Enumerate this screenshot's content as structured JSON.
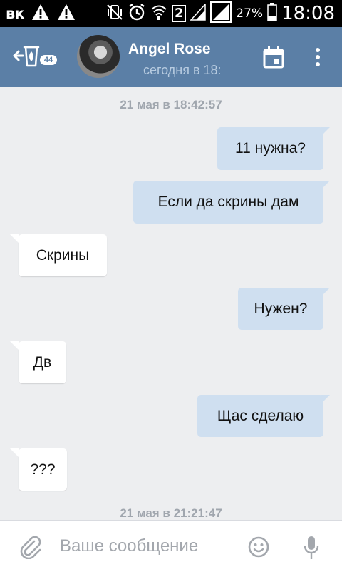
{
  "status_bar": {
    "app_logo": "вк",
    "sim_number": "2",
    "battery_percent": "27%",
    "time": "18:08",
    "icons": [
      "warning-icon",
      "warning-icon",
      "vibrate-mute-icon",
      "alarm-icon",
      "wifi-icon",
      "signal-icon",
      "signal-icon",
      "battery-icon"
    ]
  },
  "header": {
    "unread_count": "44",
    "peer_name": "Angel Rose",
    "peer_status": "сегодня в 18:",
    "colors": {
      "background": "#5b7fa6",
      "status_text": "#b7cbe0"
    },
    "icons": [
      "back-arrow-icon",
      "calendar-icon",
      "more-vertical-icon"
    ]
  },
  "chat": {
    "date_separators": [
      "21 мая в 18:42:57",
      "21 мая в 21:21:47"
    ],
    "messages": [
      {
        "direction": "out",
        "text": "11 нужна?"
      },
      {
        "direction": "out",
        "text": "Если да скрины дам"
      },
      {
        "direction": "in",
        "text": "Скрины"
      },
      {
        "direction": "out",
        "text": "Нужен?"
      },
      {
        "direction": "in",
        "text": "Дв"
      },
      {
        "direction": "out",
        "text": "Щас сделаю"
      },
      {
        "direction": "in",
        "text": "???"
      }
    ],
    "colors": {
      "background": "#edeef0",
      "outgoing_bubble": "#cfdff0",
      "incoming_bubble": "#ffffff"
    }
  },
  "composer": {
    "placeholder": "Ваше сообщение",
    "value": "",
    "icons": [
      "attachment-icon",
      "emoji-icon",
      "microphone-icon"
    ]
  }
}
